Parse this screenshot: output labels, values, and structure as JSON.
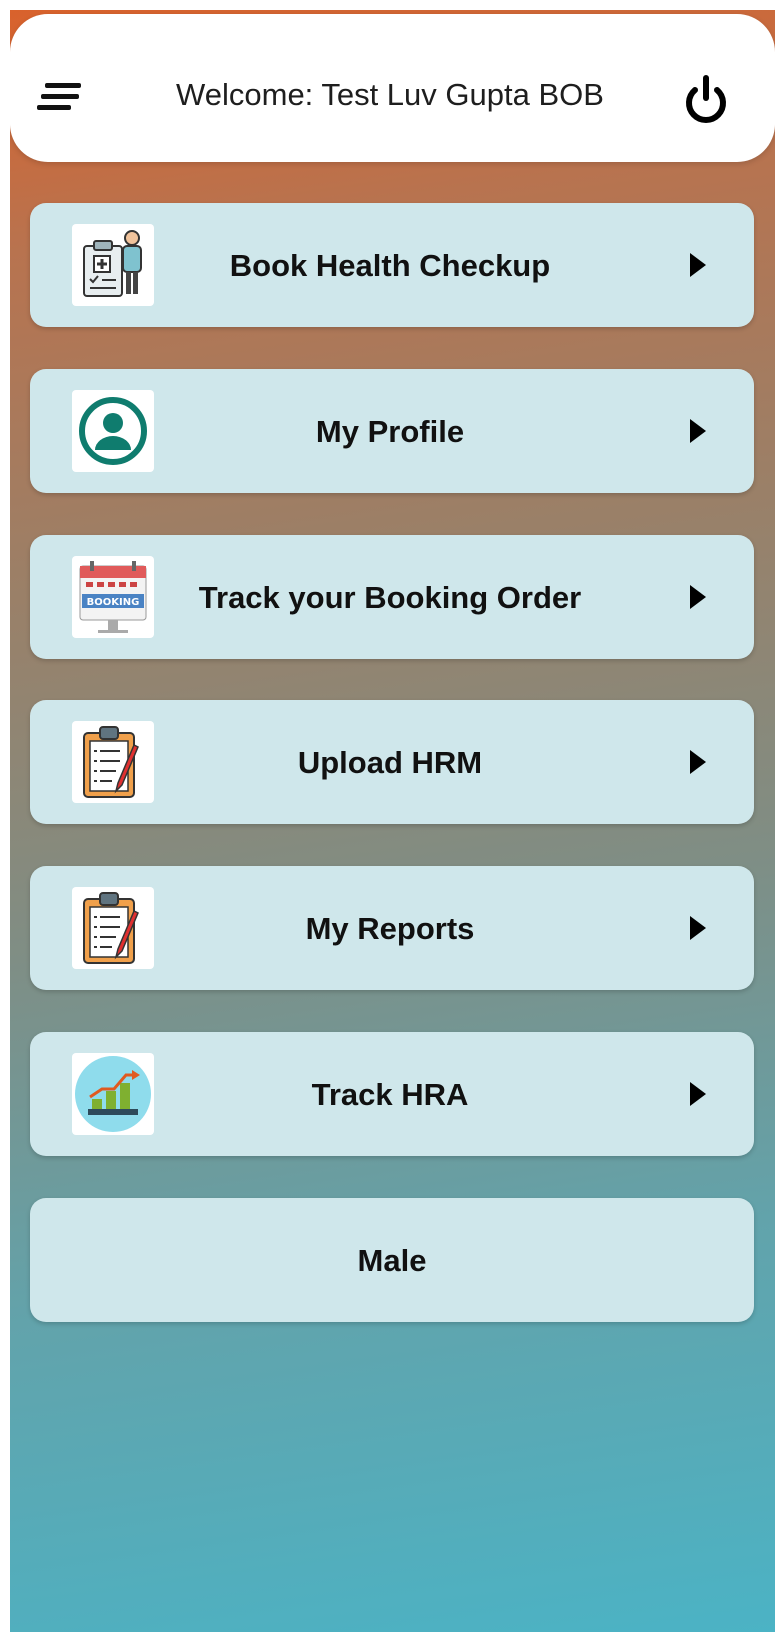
{
  "header": {
    "welcome_text": "Welcome: Test Luv Gupta BOB",
    "menu_icon": "hamburger-menu-icon",
    "power_icon": "power-icon"
  },
  "menu_items": [
    {
      "label": "Book Health Checkup",
      "icon": "health-checkup-icon"
    },
    {
      "label": "My Profile",
      "icon": "profile-icon"
    },
    {
      "label": "Track your Booking Order",
      "icon": "booking-calendar-icon"
    },
    {
      "label": "Upload HRM",
      "icon": "clipboard-icon"
    },
    {
      "label": "My Reports",
      "icon": "clipboard-icon"
    },
    {
      "label": "Track HRA",
      "icon": "growth-chart-icon"
    }
  ],
  "gender": {
    "label": "Male"
  },
  "colors": {
    "card_bg": "#cfe7eb",
    "gradient_top": "#d9622c",
    "gradient_bottom": "#4bb3c5"
  }
}
